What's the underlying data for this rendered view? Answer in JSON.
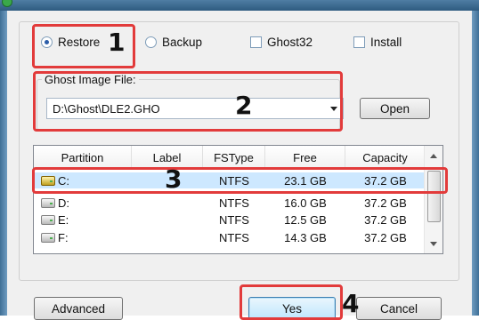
{
  "options": {
    "restore": {
      "label": "Restore",
      "checked": true
    },
    "backup": {
      "label": "Backup",
      "checked": false
    },
    "ghost32": {
      "label": "Ghost32",
      "checked": false
    },
    "install": {
      "label": "Install",
      "checked": false
    }
  },
  "ghost_image": {
    "legend": "Ghost Image File:",
    "value": "D:\\Ghost\\DLE2.GHO",
    "open_label": "Open"
  },
  "partitions": {
    "columns": [
      "Partition",
      "Label",
      "FSType",
      "Free",
      "Capacity"
    ],
    "rows": [
      {
        "partition": "C:",
        "label": "",
        "fstype": "NTFS",
        "free": "23.1 GB",
        "capacity": "37.2 GB",
        "icon": "system-drive-icon"
      },
      {
        "partition": "D:",
        "label": "",
        "fstype": "NTFS",
        "free": "16.0 GB",
        "capacity": "37.2 GB",
        "icon": "drive-icon"
      },
      {
        "partition": "E:",
        "label": "",
        "fstype": "NTFS",
        "free": "12.5 GB",
        "capacity": "37.2 GB",
        "icon": "drive-icon"
      },
      {
        "partition": "F:",
        "label": "",
        "fstype": "NTFS",
        "free": "14.3 GB",
        "capacity": "37.2 GB",
        "icon": "drive-icon"
      }
    ]
  },
  "buttons": {
    "advanced": "Advanced",
    "yes": "Yes",
    "cancel": "Cancel"
  },
  "callouts": [
    "1",
    "2",
    "3",
    "4"
  ],
  "colors": {
    "callout": "#e23b3b",
    "selection": "#cde8ff"
  }
}
